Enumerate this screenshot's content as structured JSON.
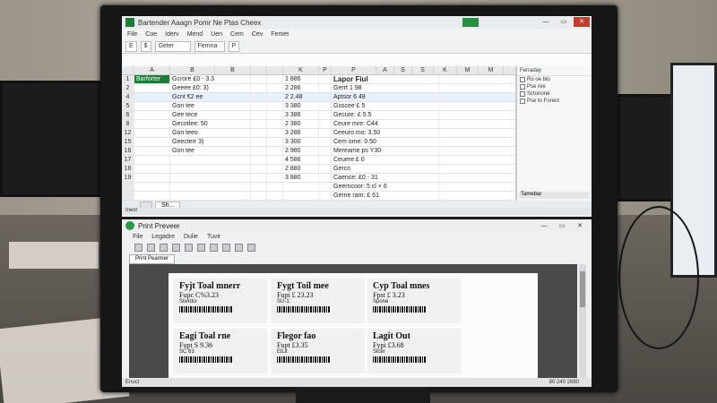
{
  "excel": {
    "title": "Bartender   Aaagn Pomr Ne Ptas Cheex",
    "window_buttons": [
      "—",
      "▭",
      "✕"
    ],
    "menu": [
      "File",
      "Coe",
      "Iderv",
      "Mend",
      "Uen",
      "Cem",
      "Cev",
      "Femet"
    ],
    "toolbar": [
      "E",
      "$",
      "Geter",
      "Femna",
      "P"
    ],
    "columns": [
      "",
      "A",
      "B",
      "B",
      "",
      "",
      "K",
      "P",
      "P",
      "A",
      "S",
      "S",
      "K",
      "M",
      "M"
    ],
    "rows": [
      {
        "n": "1",
        "a": "Barforter",
        "b": "Gcrore £0 - 3.3",
        "k": "1 886",
        "p": "Lapor Fiul"
      },
      {
        "n": "2",
        "a": "",
        "b": "Geeee £0: 3)",
        "k": "2 286",
        "p": "Gerrt 1 98"
      },
      {
        "n": "4",
        "a": "",
        "b": "Gcnt €2 ee",
        "k": "2 2.48",
        "p": "Aptsor 6 48"
      },
      {
        "n": "5",
        "a": "",
        "b": "Gon tee",
        "k": "3 380",
        "p": "Gsscee  £ 5"
      },
      {
        "n": "6",
        "a": "",
        "b": "Gee tece",
        "k": "3 386",
        "p": "Gecure: £ 5.5"
      },
      {
        "n": "8",
        "a": "",
        "b": "Gecotlee: 50",
        "k": "2 380",
        "p": "Ceure mre: C44"
      },
      {
        "n": "12",
        "a": "",
        "b": "Gon teeo",
        "k": "3 286",
        "p": "Ceeuro mo: 3.50"
      },
      {
        "n": "15",
        "a": "",
        "b": "Geecterr 3)",
        "k": "3 300",
        "p": "Cem ome:  0.50"
      },
      {
        "n": "16",
        "a": "",
        "b": "Gon tee",
        "k": "2 980",
        "p": "Mereame ps Y30"
      },
      {
        "n": "17",
        "a": "",
        "b": "",
        "k": "4 586",
        "p": "Ceuere  £ 0"
      },
      {
        "n": "18",
        "a": "",
        "b": "",
        "k": "2 880",
        "p": "Gerco"
      },
      {
        "n": "19",
        "a": "",
        "b": "",
        "k": "3 880",
        "p": "Caence:  £0 - 31"
      },
      {
        "n": "",
        "a": "",
        "b": "",
        "k": "",
        "p": "Geerncoor: 5 cl ×  6"
      },
      {
        "n": "",
        "a": "",
        "b": "",
        "k": "",
        "p": "Gerne ram: £ 61"
      }
    ],
    "sheet_tabs": [
      "",
      "Sh..."
    ],
    "status": "Inest",
    "taskpane": {
      "header": "Ferraday",
      "items": [
        "Ro oe blo",
        "Pse ree",
        "Sctonone",
        "Pse to Forent"
      ],
      "footer": "Tamebar"
    }
  },
  "print_preview": {
    "title": "Print Preveer",
    "menu": [
      "File",
      "Legadre",
      "Dulie",
      "Tuvir"
    ],
    "tab": "Print Pearmer",
    "labels": [
      {
        "title": "Fyjt Toal mnerr",
        "price": "Fupc C%3.23",
        "sub": "Siwrdcr"
      },
      {
        "title": "Fygt Toil mee",
        "price": "Fupi £ 23.23",
        "sub": "SU-1:"
      },
      {
        "title": "Cyp Toal mnes",
        "price": "Fpst £ 3.23",
        "sub": "Spone"
      },
      {
        "title": "Eagi Toal rne",
        "price": "Fupt S 9.36",
        "sub": "SC 63"
      },
      {
        "title": "Flegor fao",
        "price": "Fupt £3.35",
        "sub": "ElLit"
      },
      {
        "title": "Lagit Out",
        "price": "Fypi £3.68",
        "sub": "Sicer"
      }
    ],
    "status_left": "Enoct",
    "status_right": "80 240 2680"
  },
  "colors": {
    "excel_green": "#1d7a37",
    "selection": "#e7f0fb",
    "close_red": "#c63a2f"
  }
}
